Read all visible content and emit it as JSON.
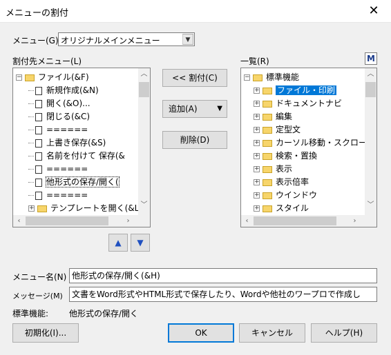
{
  "window": {
    "title": "メニューの割付",
    "close_glyph": "✕"
  },
  "menu_select": {
    "label": "メニュー(G)",
    "value": "オリジナルメインメニュー",
    "arrow": "▼"
  },
  "left_panel": {
    "label": "割付先メニュー(L)",
    "root": "ファイル(&F)",
    "items": [
      "新規作成(&N)",
      "開く(&O)...",
      "閉じる(&C)",
      "======",
      "上書き保存(&S)",
      "名前を付けて 保存(&",
      "======",
      "他形式の保存/開く(",
      "======"
    ],
    "last_folder": "テンプレートを開く(&L"
  },
  "middle_buttons": {
    "assign": "<< 割付(C)",
    "add": "追加(A)",
    "add_arrow": "▼",
    "delete": "削除(D)",
    "up": "▲",
    "down": "▼"
  },
  "right_panel": {
    "label": "一覧(R)",
    "m_button": "M",
    "root": "標準機能",
    "items": [
      "ファイル・印刷",
      "ドキュメントナビ",
      "編集",
      "定型文",
      "カーソル移動・スクロー",
      "検索・置換",
      "表示",
      "表示倍率",
      "ウインドウ",
      "スタイル"
    ]
  },
  "fields": {
    "menu_name_label": "メニュー名(N)",
    "menu_name_value": "他形式の保存/開く(&H)",
    "message_label": "メッセージ(M)",
    "message_value": "文書をWord形式やHTML形式で保存したり、Wordや他社のワープロで作成し",
    "standard_label": "標準機能:",
    "standard_value": "他形式の保存/開く"
  },
  "footer": {
    "init": "初期化(I)...",
    "ok": "OK",
    "cancel": "キャンセル",
    "help": "ヘルプ(H)"
  },
  "colors": {
    "selection": "#0078d7",
    "accent": "#0078d7",
    "folder": "#f7d56b"
  },
  "icons": {
    "expand": "⊞",
    "collapse": "⊟"
  }
}
